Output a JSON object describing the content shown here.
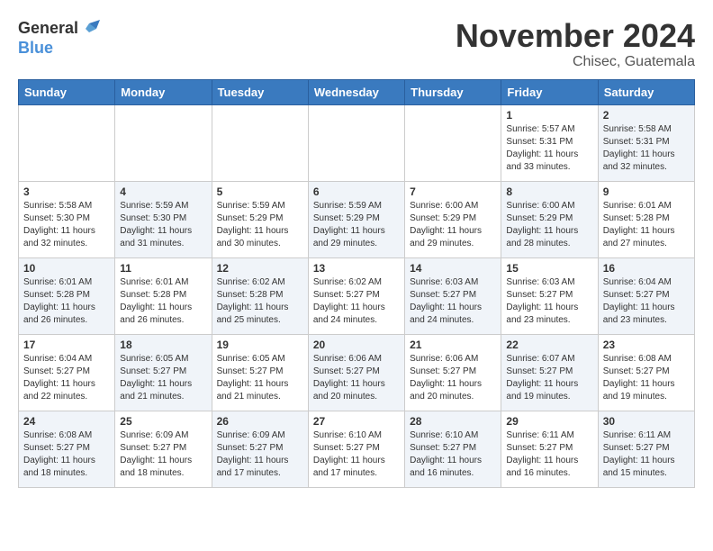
{
  "header": {
    "logo_general": "General",
    "logo_blue": "Blue",
    "month_title": "November 2024",
    "location": "Chisec, Guatemala"
  },
  "days_of_week": [
    "Sunday",
    "Monday",
    "Tuesday",
    "Wednesday",
    "Thursday",
    "Friday",
    "Saturday"
  ],
  "weeks": [
    [
      {
        "day": "",
        "info": ""
      },
      {
        "day": "",
        "info": ""
      },
      {
        "day": "",
        "info": ""
      },
      {
        "day": "",
        "info": ""
      },
      {
        "day": "",
        "info": ""
      },
      {
        "day": "1",
        "info": "Sunrise: 5:57 AM\nSunset: 5:31 PM\nDaylight: 11 hours\nand 33 minutes."
      },
      {
        "day": "2",
        "info": "Sunrise: 5:58 AM\nSunset: 5:31 PM\nDaylight: 11 hours\nand 32 minutes."
      }
    ],
    [
      {
        "day": "3",
        "info": "Sunrise: 5:58 AM\nSunset: 5:30 PM\nDaylight: 11 hours\nand 32 minutes."
      },
      {
        "day": "4",
        "info": "Sunrise: 5:59 AM\nSunset: 5:30 PM\nDaylight: 11 hours\nand 31 minutes."
      },
      {
        "day": "5",
        "info": "Sunrise: 5:59 AM\nSunset: 5:29 PM\nDaylight: 11 hours\nand 30 minutes."
      },
      {
        "day": "6",
        "info": "Sunrise: 5:59 AM\nSunset: 5:29 PM\nDaylight: 11 hours\nand 29 minutes."
      },
      {
        "day": "7",
        "info": "Sunrise: 6:00 AM\nSunset: 5:29 PM\nDaylight: 11 hours\nand 29 minutes."
      },
      {
        "day": "8",
        "info": "Sunrise: 6:00 AM\nSunset: 5:29 PM\nDaylight: 11 hours\nand 28 minutes."
      },
      {
        "day": "9",
        "info": "Sunrise: 6:01 AM\nSunset: 5:28 PM\nDaylight: 11 hours\nand 27 minutes."
      }
    ],
    [
      {
        "day": "10",
        "info": "Sunrise: 6:01 AM\nSunset: 5:28 PM\nDaylight: 11 hours\nand 26 minutes."
      },
      {
        "day": "11",
        "info": "Sunrise: 6:01 AM\nSunset: 5:28 PM\nDaylight: 11 hours\nand 26 minutes."
      },
      {
        "day": "12",
        "info": "Sunrise: 6:02 AM\nSunset: 5:28 PM\nDaylight: 11 hours\nand 25 minutes."
      },
      {
        "day": "13",
        "info": "Sunrise: 6:02 AM\nSunset: 5:27 PM\nDaylight: 11 hours\nand 24 minutes."
      },
      {
        "day": "14",
        "info": "Sunrise: 6:03 AM\nSunset: 5:27 PM\nDaylight: 11 hours\nand 24 minutes."
      },
      {
        "day": "15",
        "info": "Sunrise: 6:03 AM\nSunset: 5:27 PM\nDaylight: 11 hours\nand 23 minutes."
      },
      {
        "day": "16",
        "info": "Sunrise: 6:04 AM\nSunset: 5:27 PM\nDaylight: 11 hours\nand 23 minutes."
      }
    ],
    [
      {
        "day": "17",
        "info": "Sunrise: 6:04 AM\nSunset: 5:27 PM\nDaylight: 11 hours\nand 22 minutes."
      },
      {
        "day": "18",
        "info": "Sunrise: 6:05 AM\nSunset: 5:27 PM\nDaylight: 11 hours\nand 21 minutes."
      },
      {
        "day": "19",
        "info": "Sunrise: 6:05 AM\nSunset: 5:27 PM\nDaylight: 11 hours\nand 21 minutes."
      },
      {
        "day": "20",
        "info": "Sunrise: 6:06 AM\nSunset: 5:27 PM\nDaylight: 11 hours\nand 20 minutes."
      },
      {
        "day": "21",
        "info": "Sunrise: 6:06 AM\nSunset: 5:27 PM\nDaylight: 11 hours\nand 20 minutes."
      },
      {
        "day": "22",
        "info": "Sunrise: 6:07 AM\nSunset: 5:27 PM\nDaylight: 11 hours\nand 19 minutes."
      },
      {
        "day": "23",
        "info": "Sunrise: 6:08 AM\nSunset: 5:27 PM\nDaylight: 11 hours\nand 19 minutes."
      }
    ],
    [
      {
        "day": "24",
        "info": "Sunrise: 6:08 AM\nSunset: 5:27 PM\nDaylight: 11 hours\nand 18 minutes."
      },
      {
        "day": "25",
        "info": "Sunrise: 6:09 AM\nSunset: 5:27 PM\nDaylight: 11 hours\nand 18 minutes."
      },
      {
        "day": "26",
        "info": "Sunrise: 6:09 AM\nSunset: 5:27 PM\nDaylight: 11 hours\nand 17 minutes."
      },
      {
        "day": "27",
        "info": "Sunrise: 6:10 AM\nSunset: 5:27 PM\nDaylight: 11 hours\nand 17 minutes."
      },
      {
        "day": "28",
        "info": "Sunrise: 6:10 AM\nSunset: 5:27 PM\nDaylight: 11 hours\nand 16 minutes."
      },
      {
        "day": "29",
        "info": "Sunrise: 6:11 AM\nSunset: 5:27 PM\nDaylight: 11 hours\nand 16 minutes."
      },
      {
        "day": "30",
        "info": "Sunrise: 6:11 AM\nSunset: 5:27 PM\nDaylight: 11 hours\nand 15 minutes."
      }
    ]
  ]
}
